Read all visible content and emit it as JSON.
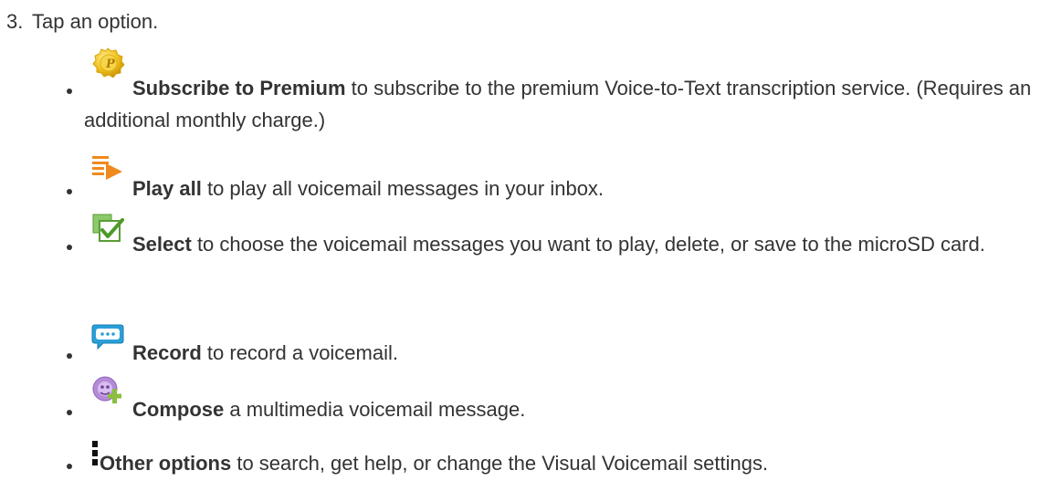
{
  "step": {
    "number": "3.",
    "text": "Tap an option."
  },
  "options": [
    {
      "icon": "premium-coin-icon",
      "term": "Subscribe to Premium",
      "description": " to subscribe to the premium Voice-to-Text transcription service. (Requires an additional monthly charge.)"
    },
    {
      "icon": "play-all-icon",
      "term": "Play all",
      "description": " to play all voicemail messages in your inbox."
    },
    {
      "icon": "select-checkbox-icon",
      "term": "Select",
      "description": " to choose the voicemail messages you want to play, delete, or save to the microSD card."
    },
    {
      "icon": "record-bubble-icon",
      "term": "Record",
      "description": " to record a voicemail."
    },
    {
      "icon": "compose-icon",
      "term": "Compose",
      "description": " a multimedia voicemail message."
    },
    {
      "icon": "menu-dots-icon",
      "term": "Other options",
      "description": " to search, get help, or change the Visual Voicemail settings."
    }
  ],
  "colors": {
    "text": "#333333",
    "premium_coin": "#f2c21b",
    "play_all": "#f08a1c",
    "select_green": "#6ab43e",
    "record_blue": "#2a9fd8",
    "compose_purple": "#b58ad8"
  }
}
